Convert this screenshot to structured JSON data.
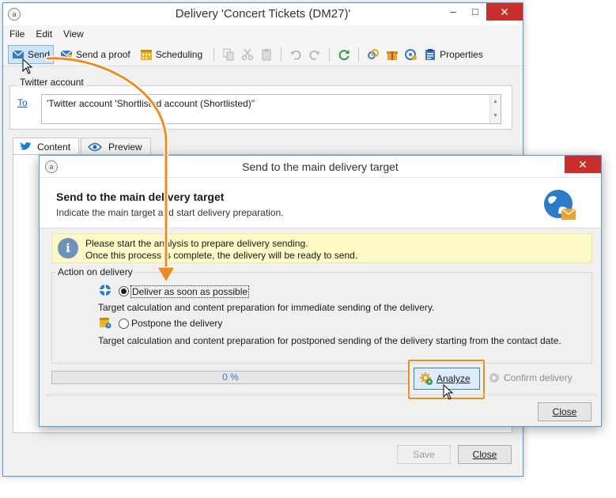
{
  "main_window": {
    "title": "Delivery 'Concert Tickets (DM27)'",
    "menu": [
      "File",
      "Edit",
      "View"
    ],
    "toolbar": {
      "send_label": "Send",
      "send_proof_label": "Send a proof",
      "scheduling_label": "Scheduling",
      "properties_label": "Properties"
    },
    "twitter_account_label": "Twitter account",
    "to_link": "To",
    "to_value": "'Twitter account 'Shortlisted account (Shortlisted)''",
    "tabs": [
      "Content",
      "Preview"
    ],
    "footer": {
      "save_label": "Save",
      "close_label": "Close"
    }
  },
  "dialog": {
    "title": "Send to the main delivery target",
    "header_title": "Send to the main delivery target",
    "header_subtitle": "Indicate the main target and start delivery preparation.",
    "info_line1": "Please start the analysis to prepare delivery sending.",
    "info_line2": "Once this process is complete, the delivery will be ready to send.",
    "action_legend": "Action on delivery",
    "options": [
      {
        "label": "Deliver as soon as possible",
        "description": "Target calculation and content preparation for immediate sending of the delivery.",
        "checked": true
      },
      {
        "label": "Postpone the delivery",
        "description": "Target calculation and content preparation for postponed sending of the delivery starting from the contact date.",
        "checked": false
      }
    ],
    "progress_text": "0 %",
    "progress_value": 0,
    "analyze_label": "Analyze",
    "confirm_label": "Confirm delivery",
    "close_label": "Close"
  },
  "colors": {
    "highlight": "#f08a24",
    "window_border": "#5b9bd5",
    "close_red": "#c7302a",
    "info_band": "#fcf9c6",
    "link_blue": "#1c5fb8"
  }
}
